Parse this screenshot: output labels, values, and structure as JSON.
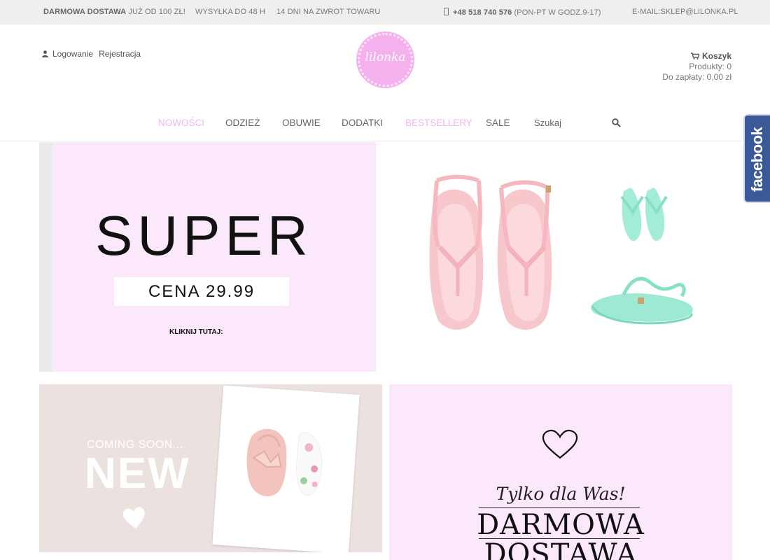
{
  "topbar": {
    "free_shipping_bold": "DARMOWA DOSTAWA",
    "free_shipping_rest": " JUŻ OD 100 ZŁ!",
    "shipping_time": "WYSYŁKA DO 48 H",
    "returns": "14 DNI NA ZWROT TOWARU",
    "phone_number": "+48 518 740 576",
    "phone_hours": " (PON-PT W GODZ.9-17)",
    "email": "E-MAIL:SKLEP@LILONKA.PL"
  },
  "header": {
    "login_label": "Logowanie",
    "register_label": "Rejestracja",
    "logo_text": "lilonka",
    "cart": {
      "title": "Koszyk",
      "products": "Produkty: 0",
      "total": "Do zapłaty: 0,00 zł"
    }
  },
  "nav": {
    "items": [
      {
        "label": "NOWOŚCI",
        "highlight": true
      },
      {
        "label": "ODZIEŻ",
        "highlight": false
      },
      {
        "label": "OBUWIE",
        "highlight": false
      },
      {
        "label": "DODATKI",
        "highlight": false
      },
      {
        "label": "BESTSELLERY",
        "highlight": true
      },
      {
        "label": "SALE",
        "highlight": false
      }
    ],
    "search_label": "Szukaj",
    "search_icon": "search-icon"
  },
  "banners": {
    "super": {
      "title": "SUPER",
      "price": "CENA 29.99",
      "cta": "KLIKNIJ TUTAJ:"
    },
    "coming": {
      "coming_text": "COMING SOON...",
      "new_text": "NEW"
    },
    "free_delivery": {
      "tagline": "Tylko dla Was!",
      "line1": "DARMOWA",
      "line2": "DOSTAWA"
    }
  },
  "facebook": {
    "label": "facebook"
  },
  "colors": {
    "brand_pink": "#f5b1ee",
    "nav_highlight": "#f4b6ee",
    "banner_pink": "#fbe8fb",
    "facebook_blue": "#3b5998"
  }
}
